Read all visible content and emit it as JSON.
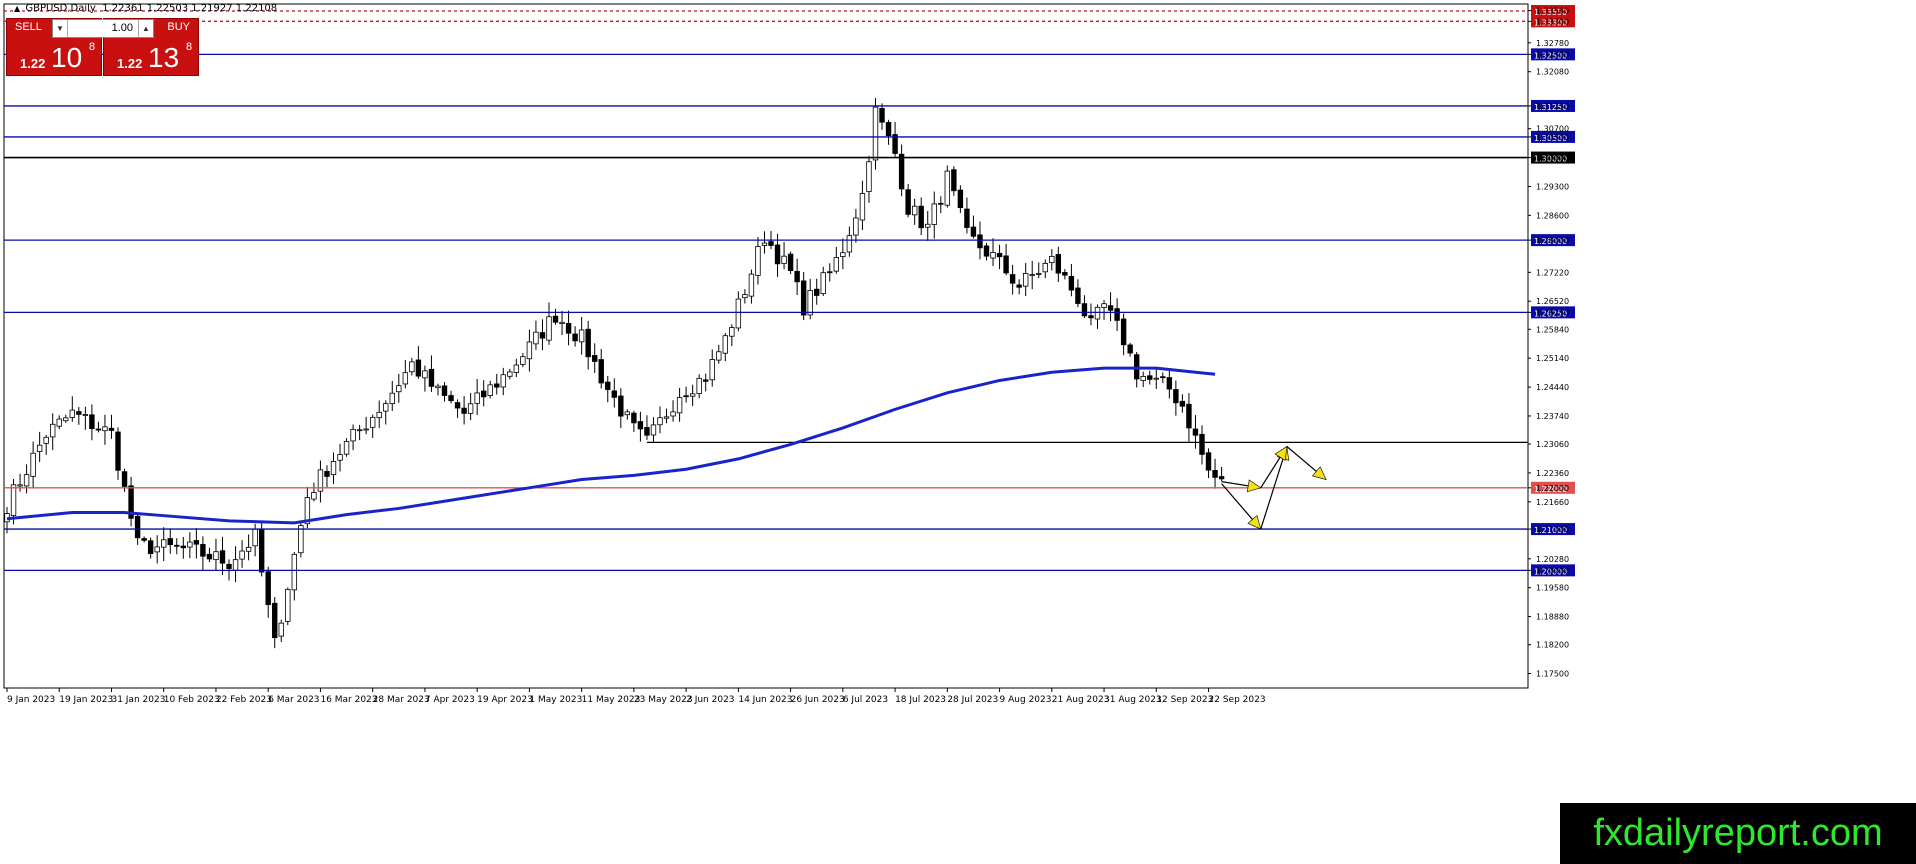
{
  "header": {
    "symbol": "GBPUSD,Daily",
    "ohlc": "1.22361 1.22503 1.21927 1.22108"
  },
  "trade_panel": {
    "sell_label": "SELL",
    "buy_label": "BUY",
    "quantity": "1.00",
    "sell_price_prefix": "1.22",
    "sell_price_big": "10",
    "sell_price_sup": "8",
    "buy_price_prefix": "1.22",
    "buy_price_big": "13",
    "buy_price_sup": "8"
  },
  "watermark": "fxdailyreport.com",
  "colors": {
    "background": "#ffffff",
    "candle_outline": "#000000",
    "bull_body": "#ffffff",
    "bear_body": "#000000",
    "moving_average": "#1a23c8",
    "level_line": "#0a0aa8",
    "resistance_dashed": "#c81010",
    "current_price_line": "#e05050",
    "arrow_fill": "#f2e01a",
    "panel_red": "#c81010",
    "watermark_text": "#2ee82e"
  },
  "chart_data": {
    "type": "candlestick",
    "ylim": [
      1.1715,
      1.3372
    ],
    "y_ticks": [
      "1.33560",
      "1.33300",
      "1.32780",
      "1.32500",
      "1.32080",
      "1.31250",
      "1.30700",
      "1.30500",
      "1.30000",
      "1.29300",
      "1.28600",
      "1.28000",
      "1.27220",
      "1.26520",
      "1.26250",
      "1.25840",
      "1.25140",
      "1.24440",
      "1.23740",
      "1.23060",
      "1.22360",
      "1.22000",
      "1.21660",
      "1.21000",
      "1.20280",
      "1.20000",
      "1.19580",
      "1.18880",
      "1.18200",
      "1.17500"
    ],
    "x_tick_labels": [
      "9 Jan 2023",
      "19 Jan 2023",
      "31 Jan 2023",
      "10 Feb 2023",
      "22 Feb 2023",
      "6 Mar 2023",
      "16 Mar 2023",
      "28 Mar 2023",
      "7 Apr 2023",
      "19 Apr 2023",
      "1 May 2023",
      "11 May 2023",
      "23 May 2023",
      "2 Jun 2023",
      "14 Jun 2023",
      "26 Jun 2023",
      "6 Jul 2023",
      "18 Jul 2023",
      "28 Jul 2023",
      "9 Aug 2023",
      "21 Aug 2023",
      "31 Aug 2023",
      "12 Sep 2023",
      "22 Sep 2023"
    ],
    "x_tick_index": [
      0,
      8,
      16,
      24,
      32,
      40,
      48,
      56,
      64,
      72,
      80,
      88,
      96,
      104,
      112,
      120,
      128,
      136,
      144,
      152,
      160,
      168,
      176,
      184
    ],
    "bars_visible": 187,
    "close_anchors": [
      [
        0,
        1.216
      ],
      [
        6,
        1.233
      ],
      [
        10,
        1.238
      ],
      [
        16,
        1.233
      ],
      [
        20,
        1.206
      ],
      [
        28,
        1.205
      ],
      [
        34,
        1.202
      ],
      [
        38,
        1.208
      ],
      [
        41,
        1.182
      ],
      [
        46,
        1.218
      ],
      [
        50,
        1.227
      ],
      [
        58,
        1.241
      ],
      [
        62,
        1.25
      ],
      [
        66,
        1.243
      ],
      [
        70,
        1.238
      ],
      [
        76,
        1.247
      ],
      [
        80,
        1.254
      ],
      [
        84,
        1.262
      ],
      [
        88,
        1.256
      ],
      [
        92,
        1.244
      ],
      [
        96,
        1.234
      ],
      [
        98,
        1.231
      ],
      [
        103,
        1.243
      ],
      [
        107,
        1.247
      ],
      [
        110,
        1.256
      ],
      [
        113,
        1.268
      ],
      [
        116,
        1.281
      ],
      [
        120,
        1.272
      ],
      [
        122,
        1.264
      ],
      [
        126,
        1.272
      ],
      [
        128,
        1.278
      ],
      [
        131,
        1.291
      ],
      [
        133,
        1.311
      ],
      [
        136,
        1.301
      ],
      [
        138,
        1.288
      ],
      [
        141,
        1.283
      ],
      [
        144,
        1.295
      ],
      [
        147,
        1.281
      ],
      [
        151,
        1.276
      ],
      [
        155,
        1.269
      ],
      [
        160,
        1.275
      ],
      [
        164,
        1.266
      ],
      [
        166,
        1.259
      ],
      [
        168,
        1.264
      ],
      [
        171,
        1.256
      ],
      [
        173,
        1.248
      ],
      [
        175,
        1.246
      ],
      [
        178,
        1.244
      ],
      [
        180,
        1.24
      ],
      [
        182,
        1.232
      ],
      [
        184,
        1.224
      ],
      [
        186,
        1.221
      ]
    ],
    "moving_average": {
      "name": "",
      "points": [
        [
          0,
          1.2125
        ],
        [
          10,
          1.214
        ],
        [
          18,
          1.214
        ],
        [
          26,
          1.213
        ],
        [
          34,
          1.212
        ],
        [
          44,
          1.2115
        ],
        [
          52,
          1.2135
        ],
        [
          60,
          1.215
        ],
        [
          70,
          1.2175
        ],
        [
          80,
          1.22
        ],
        [
          88,
          1.222
        ],
        [
          96,
          1.223
        ],
        [
          104,
          1.2245
        ],
        [
          112,
          1.227
        ],
        [
          120,
          1.2305
        ],
        [
          128,
          1.2345
        ],
        [
          136,
          1.239
        ],
        [
          144,
          1.243
        ],
        [
          152,
          1.246
        ],
        [
          160,
          1.248
        ],
        [
          168,
          1.249
        ],
        [
          176,
          1.249
        ],
        [
          182,
          1.248
        ],
        [
          185,
          1.2475
        ]
      ]
    },
    "horizontal_levels": [
      {
        "price": 1.333,
        "label": "1.33300",
        "style": "dashed",
        "color": "#c81010"
      },
      {
        "price": 1.3355,
        "label": "1.33550",
        "style": "dashed",
        "color": "#c81010"
      },
      {
        "price": 1.325,
        "label": "1.32500",
        "style": "solid",
        "color": "#0a0aa8"
      },
      {
        "price": 1.3125,
        "label": "1.31250",
        "style": "solid",
        "color": "#0a0aa8"
      },
      {
        "price": 1.305,
        "label": "1.30500",
        "style": "solid",
        "color": "#0a0aa8"
      },
      {
        "price": 1.3,
        "label": "1.30000",
        "style": "solid",
        "color": "#000000"
      },
      {
        "price": 1.28,
        "label": "1.28000",
        "style": "solid",
        "color": "#0a0aa8"
      },
      {
        "price": 1.2625,
        "label": "1.26250",
        "style": "solid",
        "color": "#0a0aa8"
      },
      {
        "price": 1.22,
        "label": "1.22000",
        "style": "solid",
        "color": "#e05050"
      },
      {
        "price": 1.21,
        "label": "1.21000",
        "style": "solid",
        "color": "#0a0aa8"
      },
      {
        "price": 1.2,
        "label": "1.20000",
        "style": "solid",
        "color": "#0a0aa8"
      }
    ],
    "swing_low_line": {
      "start_index": 98,
      "end_index": 187,
      "price": 1.231
    },
    "projection_path": [
      [
        186,
        1.221
      ],
      [
        192,
        1.21
      ],
      [
        196,
        1.23
      ],
      [
        202,
        1.222
      ]
    ],
    "projection_path_2": [
      [
        186,
        1.2215
      ],
      [
        192,
        1.22
      ],
      [
        196,
        1.23
      ]
    ],
    "legend": "none",
    "grid": false
  }
}
